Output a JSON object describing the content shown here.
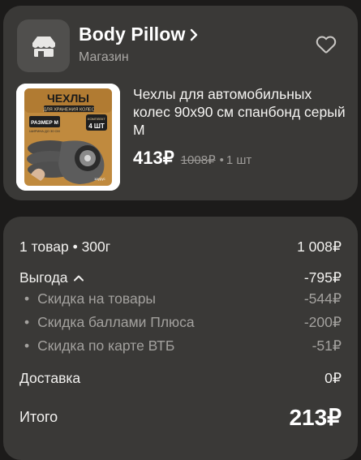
{
  "store": {
    "name": "Body Pillow",
    "type": "Магазин",
    "logo_icon": "storefront-icon",
    "favorite_icon": "heart-outline-icon"
  },
  "product": {
    "title": "Чехлы для автомобильных колес 90x90 см спанбонд серый M",
    "price": "413₽",
    "old_price": "1008₽",
    "separator": "•",
    "quantity": "1 шт",
    "image": {
      "headline": "ЧЕХЛЫ",
      "subheadline": "ДЛЯ ХРАНЕНИЯ КОЛЕС",
      "size_badge": "РАЗМЕР М",
      "size_note": "ШИРИНА ДО 30 СМ",
      "count_badge_top": "КОМПЛЕКТ",
      "count_badge": "4 ШТ",
      "brand": "заурус"
    }
  },
  "summary": {
    "items_label": "1 товар • 300г",
    "items_value": "1 008₽",
    "benefit_label": "Выгода",
    "benefit_value": "-795₽",
    "discounts": [
      {
        "label": "Скидка на товары",
        "value": "-544₽"
      },
      {
        "label": "Скидка баллами Плюса",
        "value": "-200₽"
      },
      {
        "label": "Скидка по карте ВТБ",
        "value": "-51₽"
      }
    ],
    "bullet": "•",
    "delivery_label": "Доставка",
    "delivery_value": "0₽",
    "total_label": "Итого",
    "total_value": "213₽"
  },
  "colors": {
    "background": "#1c1b1a",
    "card": "#3a3937",
    "text_primary": "#f2f1ef",
    "text_secondary": "#a3a19e"
  }
}
